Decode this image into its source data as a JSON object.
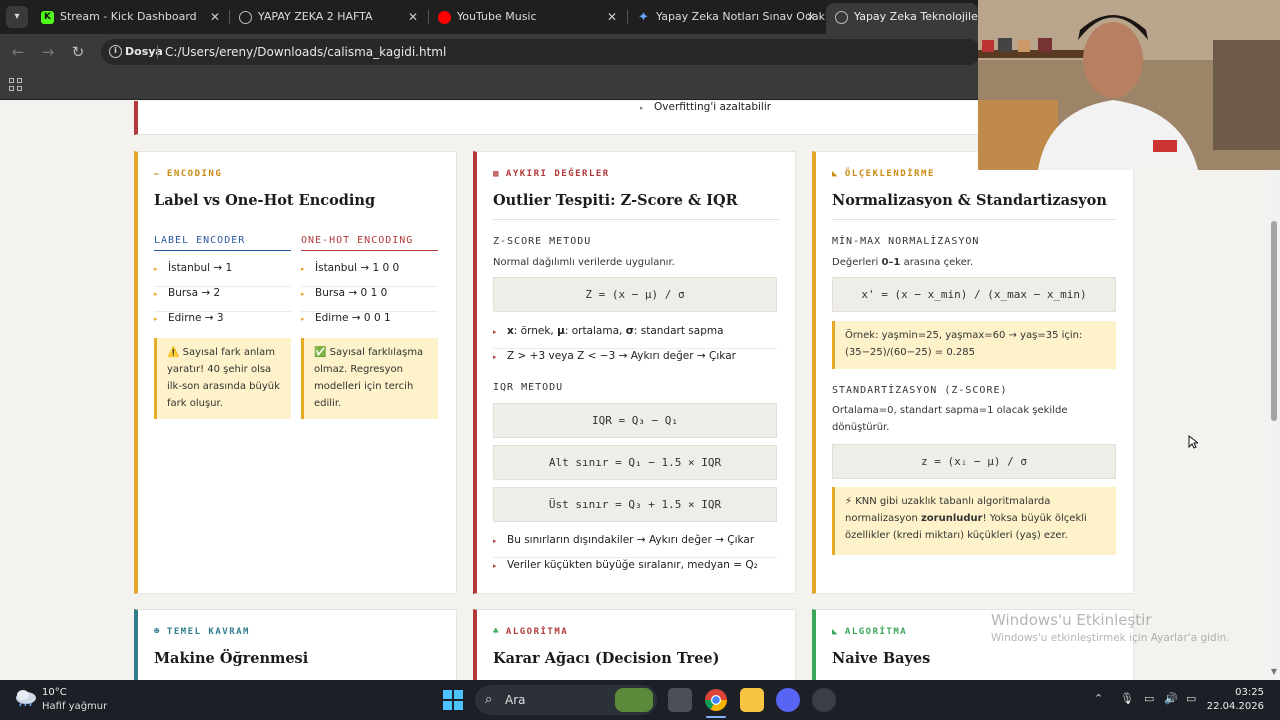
{
  "browser": {
    "tabs": [
      {
        "title": "Stream - Kick Dashboard",
        "favicon": "kick-icon",
        "color": "#53fc18"
      },
      {
        "title": "YAPAY ZEKA 2 HAFTA",
        "favicon": "globe-icon",
        "color": "#bbbbbb"
      },
      {
        "title": "YouTube Music",
        "favicon": "youtube-music-icon",
        "color": "#ff0000"
      },
      {
        "title": "Yapay Zeka Notları Sınav Odaklı",
        "favicon": "gemini-icon",
        "color": "#6aa7ff"
      },
      {
        "title": "Yapay Zeka Teknolojileri – Sı",
        "favicon": "globe-icon",
        "color": "#bbbbbb"
      }
    ],
    "address": {
      "chip": "Dosya",
      "url": "C:/Users/ereny/Downloads/calisma_kagidi.html"
    }
  },
  "page": {
    "prev_bullet": "Overfitting'i azaltabilir",
    "encoding_card": {
      "tag": "ENCODING",
      "title": "Label vs One-Hot Encoding",
      "label_header": "LABEL ENCODER",
      "onehot_header": "ONE-HOT ENCODING",
      "label_items": [
        "İstanbul → 1",
        "Bursa → 2",
        "Edirne → 3"
      ],
      "onehot_items": [
        "İstanbul → 1 0 0",
        "Bursa → 0 1 0",
        "Edirne → 0 0 1"
      ],
      "label_note": "⚠️ Sayısal fark anlam yaratır! 40 şehir olsa ilk-son arasında büyük fark oluşur.",
      "onehot_note": "✅ Sayısal farklılaşma olmaz. Regresyon modelleri için tercih edilir."
    },
    "outlier_card": {
      "tag": "AYKIRI DEĞERLER",
      "title": "Outlier Tespiti: Z-Score & IQR",
      "z_header": "Z-SCORE METODU",
      "z_desc": "Normal dağılımlı verilerde uygulanır.",
      "z_formula": "Z = (x − μ) / σ",
      "z_bullet1_parts": [
        "x",
        ": örnek, ",
        "μ",
        ": ortalama, ",
        "σ",
        ": standart sapma"
      ],
      "z_bullet2": "Z > +3 veya Z < −3 → Aykırı değer → Çıkar",
      "iqr_header": "IQR METODU",
      "iqr_formula": "IQR = Q₃ − Q₁",
      "iqr_lower": "Alt sınır = Q₁ − 1.5 × IQR",
      "iqr_upper": "Üst sınır = Q₃ + 1.5 × IQR",
      "iqr_bullet1": "Bu sınırların dışındakiler → Aykırı değer → Çıkar",
      "iqr_bullet2": "Veriler küçükten büyüğe sıralanır, medyan = Q₂"
    },
    "scaling_card": {
      "tag": "ÖLÇEKLENDİRME",
      "title": "Normalizasyon & Standartizasyon",
      "minmax_header": "MİN-MAX NORMALİZASYON",
      "minmax_desc_parts": [
        "Değerleri ",
        "0–1",
        " arasına çeker."
      ],
      "minmax_formula": "x' = (x − x_min) / (x_max − x_min)",
      "minmax_example": "Örnek: yaşmin=25, yaşmax=60 → yaş=35 için: (35−25)/(60−25) = 0.285",
      "std_header": "STANDARTİZASYON (Z-SCORE)",
      "std_desc": "Ortalama=0, standart sapma=1 olacak şekilde dönüştürür.",
      "std_formula": "z = (xᵢ − μ) / σ",
      "std_note_parts": [
        "⚡ KNN gibi uzaklık tabanlı algoritmalarda normalizasyon ",
        "zorunludur",
        "! Yoksa büyük ölçekli özellikler (kredi miktarı) küçükleri (yaş) ezer."
      ]
    },
    "bottom_cards": [
      {
        "tag": "TEMEL KAVRAM",
        "title": "Makine Öğrenmesi",
        "color": "#2f7d8c",
        "icon": "robot-icon"
      },
      {
        "tag": "ALGORİTMA",
        "title": "Karar Ağacı (Decision Tree)",
        "color": "#b23a3a",
        "icon": "tree-icon"
      },
      {
        "tag": "ALGORİTMA",
        "title": "Naive Bayes",
        "color": "#3aa65a",
        "icon": "chart-icon"
      }
    ],
    "accent_colors": {
      "encoding": "#e4a52b",
      "outlier": "#b23a3a",
      "scaling": "#e4a52b"
    }
  },
  "watermark": {
    "title": "Windows'u Etkinleştir",
    "subtitle": "Windows'u etkinleştirmek için Ayarlar'a gidin."
  },
  "taskbar": {
    "temperature": "10°C",
    "condition": "Hafif yağmur",
    "search_label": "Ara",
    "time": "03:25",
    "date": "22.04.2026"
  }
}
